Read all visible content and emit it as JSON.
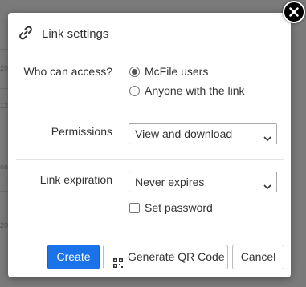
{
  "background": {
    "edge_fragments": [
      "20",
      "12",
      "oa",
      "20"
    ]
  },
  "dialog": {
    "title": "Link settings",
    "icons": {
      "title_icon": "link-icon",
      "close_icon": "close-icon",
      "qr_icon": "qr-code-icon",
      "select_arrow": "chevron-down-icon"
    },
    "access": {
      "label": "Who can access?",
      "options": [
        {
          "label": "McFile users",
          "selected": true
        },
        {
          "label": "Anyone with the link",
          "selected": false
        }
      ]
    },
    "permissions": {
      "label": "Permissions",
      "value": "View and download"
    },
    "expiration": {
      "label": "Link expiration",
      "value": "Never expires"
    },
    "password": {
      "label": "Set password",
      "checked": false
    },
    "buttons": {
      "create": "Create",
      "qr": "Generate QR Code",
      "cancel": "Cancel"
    },
    "colors": {
      "primary": "#1a73e8",
      "overlay": "#7a7a7a"
    }
  }
}
